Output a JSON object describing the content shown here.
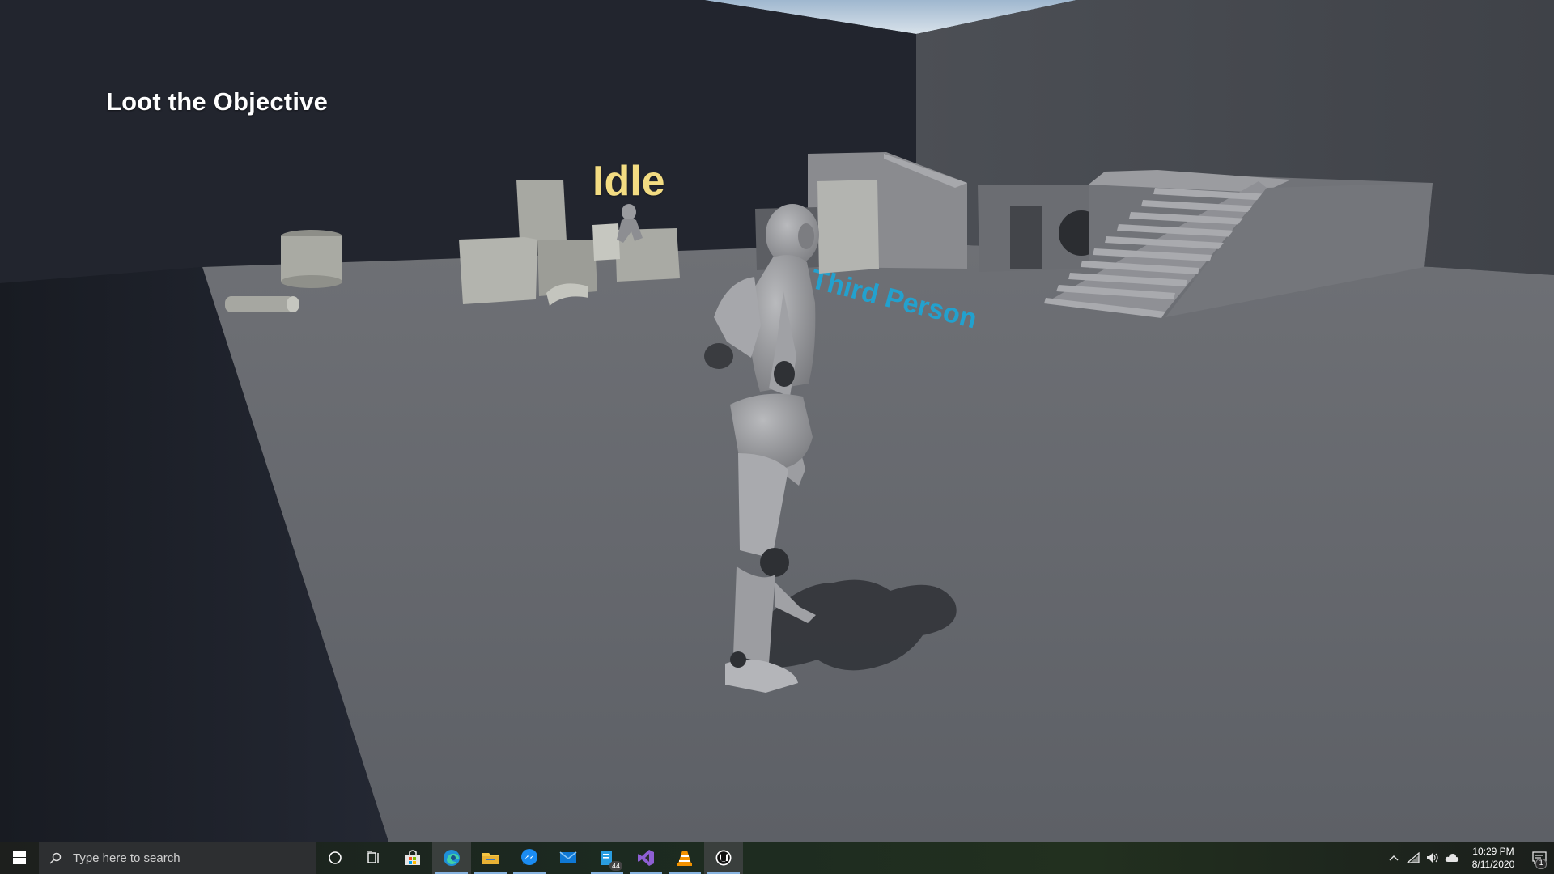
{
  "hud": {
    "objective": "Loot the Objective",
    "state": "Idle"
  },
  "scene": {
    "floor_text": "Third Person"
  },
  "taskbar": {
    "search_placeholder": "Type here to search",
    "apps": [
      {
        "name": "cortana",
        "icon": "circle-icon"
      },
      {
        "name": "task-view",
        "icon": "task-view-icon"
      },
      {
        "name": "store",
        "icon": "store-icon"
      },
      {
        "name": "edge",
        "icon": "edge-icon"
      },
      {
        "name": "file-explorer",
        "icon": "folder-icon"
      },
      {
        "name": "messenger",
        "icon": "messenger-icon"
      },
      {
        "name": "mail",
        "icon": "mail-icon"
      },
      {
        "name": "notes",
        "icon": "notes-icon",
        "badge": "44"
      },
      {
        "name": "visual-studio",
        "icon": "visual-studio-icon"
      },
      {
        "name": "vlc",
        "icon": "vlc-icon"
      },
      {
        "name": "unreal-engine",
        "icon": "unreal-icon"
      }
    ],
    "clock_time": "10:29 PM",
    "clock_date": "8/11/2020",
    "notification_count": "1"
  },
  "colors": {
    "objective_text": "#ffffff",
    "state_text": "#f3dc82",
    "floor_text": "#1ba7d8"
  }
}
